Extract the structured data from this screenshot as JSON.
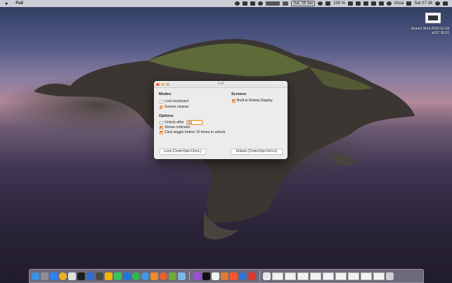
{
  "menubar": {
    "apple": "",
    "app_name": "Foil",
    "date": "Sat, 18 Jan",
    "battery": "100 %",
    "user": "khoa",
    "clock": "Sat 07:36"
  },
  "desktop": {
    "screenshot_label": "Screen Shot 2020-01-18 at 07.36.01"
  },
  "window": {
    "title": "Foil",
    "modes_heading": "Modes",
    "lock_keyboard": "Lock keyboard",
    "screen_cleaner": "Screen cleaner",
    "screens_heading": "Screens",
    "builtin_display": "Built-in Retina Display",
    "options_heading": "Options",
    "unlock_after": "Unlock after",
    "unlock_after_value": "20",
    "shows_indicator": "Shows indicator",
    "click_wiggle": "Click wiggle button 10 times to unlock",
    "lock_button": "Lock (Cmd+Opt+Ctrl+L)",
    "unlock_button": "Unlock (Cmd+Opt+Ctrl+U)"
  },
  "state": {
    "lock_keyboard_checked": false,
    "screen_cleaner_selected": true,
    "builtin_display_checked": true,
    "unlock_after_checked": false,
    "shows_indicator_checked": true,
    "click_wiggle_checked": true
  },
  "colors": {
    "accent": "#ef8a3a",
    "close": "#fc605c",
    "minimize": "#fdbc40"
  },
  "dock_icons": [
    "finder-icon",
    "launchpad-icon",
    "safari-icon",
    "chrome-icon",
    "photos-icon",
    "terminal-icon",
    "xcode-icon",
    "sublime-icon",
    "sketch-icon",
    "messages-icon",
    "vscode-icon",
    "whatsapp-icon",
    "safari-icon",
    "swift-icon",
    "firefox-icon",
    "android-studio-icon",
    "folder-icon",
    "podcasts-icon",
    "appletv-icon",
    "music-icon",
    "brave-icon",
    "vlc-icon",
    "instruments-icon",
    "simulator-icon",
    "trash-icon"
  ]
}
